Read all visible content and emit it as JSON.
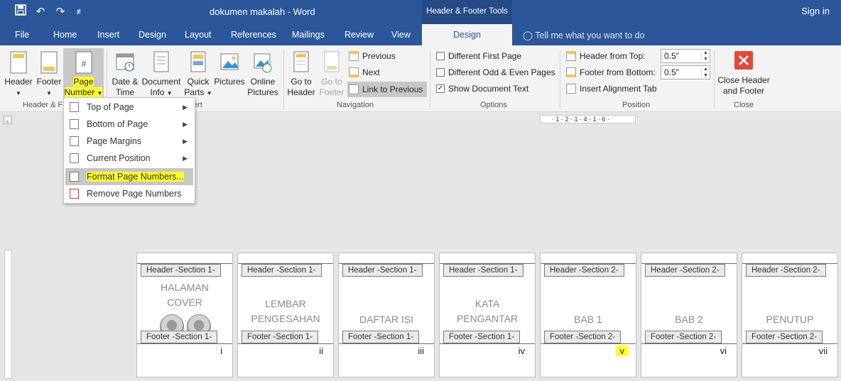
{
  "titlebar": {
    "doc_title": "dokumen makalah - Word",
    "context_tools": "Header & Footer Tools",
    "sign_in": "Sign in",
    "qat_save": "💾",
    "qat_undo": "↶",
    "qat_redo": "↷",
    "qat_more": "≢"
  },
  "tabs": {
    "file": "File",
    "home": "Home",
    "insert": "Insert",
    "design": "Design",
    "layout": "Layout",
    "references": "References",
    "mailings": "Mailings",
    "review": "Review",
    "view": "View",
    "design_active": "Design",
    "tell_me": "Tell me what you want to do"
  },
  "ribbon": {
    "header": "Header",
    "footer": "Footer",
    "page_number_1": "Page",
    "page_number_2": "Number",
    "date_time_1": "Date &",
    "date_time_2": "Time",
    "doc_info_1": "Document",
    "doc_info_2": "Info",
    "quick_parts_1": "Quick",
    "quick_parts_2": "Parts",
    "pictures": "Pictures",
    "online_pictures_1": "Online",
    "online_pictures_2": "Pictures",
    "go_to_header_1": "Go to",
    "go_to_header_2": "Header",
    "go_to_footer_1": "Go to",
    "go_to_footer_2": "Footer",
    "previous": "Previous",
    "next": "Next",
    "link_to_previous": "Link to Previous",
    "different_first_page": "Different First Page",
    "different_odd_even": "Different Odd & Even Pages",
    "show_document_text": "Show Document Text",
    "header_from_top": "Header from Top:",
    "header_from_top_value": "0.5\"",
    "footer_from_bottom": "Footer from Bottom:",
    "footer_from_bottom_value": "0.5\"",
    "insert_alignment_tab": "Insert Alignment Tab",
    "close_header_1": "Close Header",
    "close_header_2": "and Footer",
    "group_header_footer": "Header & F",
    "group_insert": "ert",
    "group_navigation": "Navigation",
    "group_options": "Options",
    "group_position": "Position",
    "group_close": "Close"
  },
  "menu": {
    "items": [
      {
        "label": "Top of Page"
      },
      {
        "label": "Bottom of Page"
      },
      {
        "label": "Page Margins"
      },
      {
        "label": "Current Position"
      },
      {
        "label": "Format Page Numbers..."
      },
      {
        "label": "Remove Page Numbers"
      }
    ]
  },
  "ruler": {
    "marks": "· 1 · 2 · 1 · 4 · 1 · 6 ·"
  },
  "pages": [
    {
      "header": "Header -Section 1-",
      "title1": "HALAMAN",
      "title2": "COVER",
      "footer": "Footer -Section 1-",
      "num": "i"
    },
    {
      "header": "Header -Section 1-",
      "title1": "LEMBAR",
      "title2": "PENGESAHAN",
      "footer": "Footer -Section 1-",
      "num": "ii"
    },
    {
      "header": "Header -Section 1-",
      "title1": "DAFTAR ISI",
      "title2": "",
      "footer": "Footer -Section 1-",
      "num": "iii"
    },
    {
      "header": "Header -Section 1-",
      "title1": "KATA",
      "title2": "PENGANTAR",
      "footer": "Footer -Section 1-",
      "num": "iv"
    },
    {
      "header": "Header -Section 2-",
      "title1": "BAB 1",
      "title2": "",
      "footer": "Footer -Section 2-",
      "num": "v"
    },
    {
      "header": "Header -Section 2-",
      "title1": "BAB 2",
      "title2": "",
      "footer": "Footer -Section 2-",
      "num": "vi"
    },
    {
      "header": "Header -Section 2-",
      "title1": "PENUTUP",
      "title2": "",
      "footer": "Footer -Section 2-",
      "num": "vii"
    }
  ],
  "colors": {
    "word_blue": "#2b579a",
    "highlight": "#ffff33",
    "close_red": "#e04a3a"
  }
}
